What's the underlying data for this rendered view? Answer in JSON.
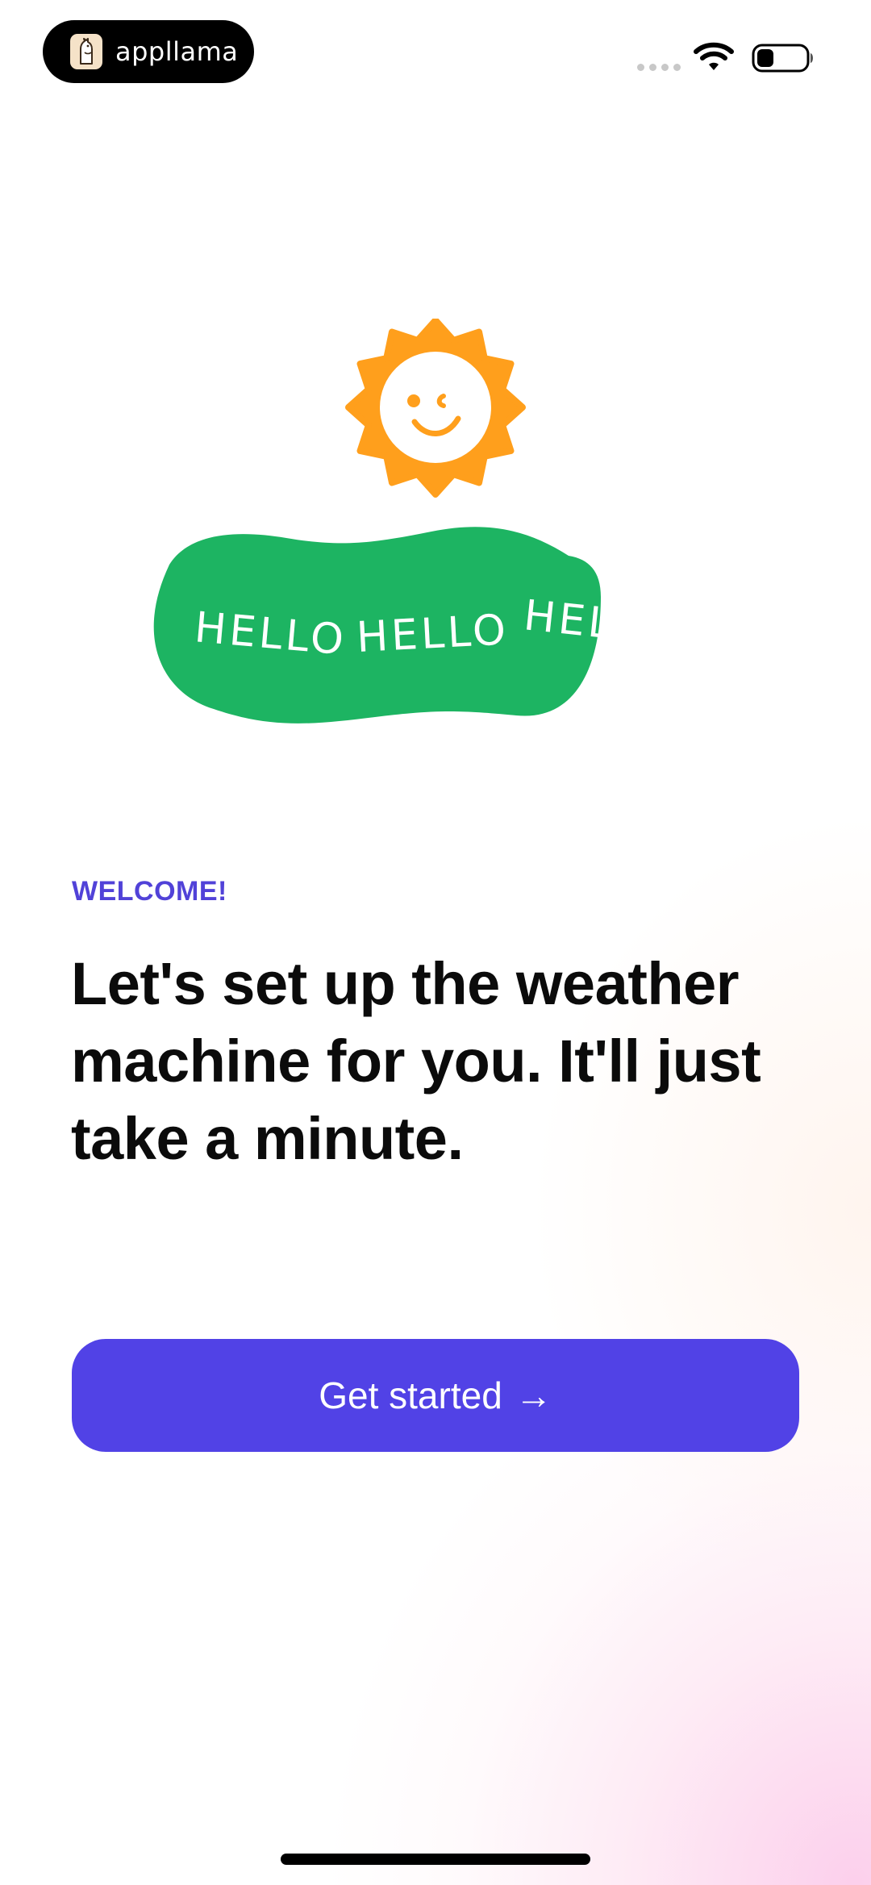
{
  "status_bar": {
    "brand": "appllama",
    "brand_icon": "llama-icon",
    "signal_icon": "signal-dots-icon",
    "wifi_icon": "wifi-icon",
    "battery_icon": "battery-icon"
  },
  "illustration": {
    "sun_icon": "smiling-sun-icon",
    "banner_text": [
      "HELLO",
      "HELLO",
      "HELLO"
    ],
    "sun_color": "#FF9F1C",
    "banner_color": "#1DB462"
  },
  "welcome": {
    "eyebrow": "WELCOME!",
    "headline_lines": [
      "Let's set up the weather",
      "machine for you. It'll just",
      "take a minute."
    ]
  },
  "cta": {
    "label": "Get started",
    "arrow": "→",
    "color": "#5142E6"
  },
  "colors": {
    "accent": "#5142D8",
    "text": "#0B0B0B",
    "background": "#FFFFFF"
  }
}
